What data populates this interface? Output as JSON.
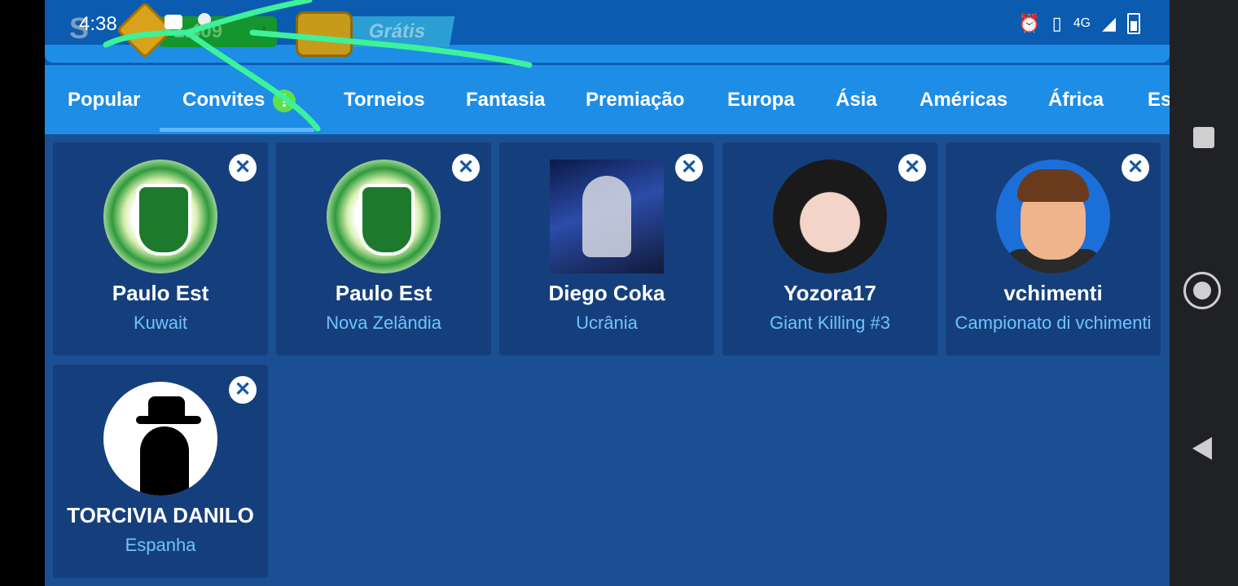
{
  "status_bar": {
    "time": "4:38",
    "network": "4G"
  },
  "header": {
    "coins": "1.409",
    "coins_plus": "+",
    "free_label": "Grátis"
  },
  "tabs": [
    {
      "label": "Popular"
    },
    {
      "label": "Convites"
    },
    {
      "label": "Torneios"
    },
    {
      "label": "Fantasia"
    },
    {
      "label": "Premiação"
    },
    {
      "label": "Europa"
    },
    {
      "label": "Ásia"
    },
    {
      "label": "Américas"
    },
    {
      "label": "África"
    },
    {
      "label": "Es"
    }
  ],
  "invites": [
    {
      "name": "Paulo Est",
      "subtitle": "Kuwait",
      "avatar": "sporting-crest"
    },
    {
      "name": "Paulo Est",
      "subtitle": "Nova Zelândia",
      "avatar": "sporting-crest"
    },
    {
      "name": "Diego Coka",
      "subtitle": "Ucrânia",
      "avatar": "game-dragon"
    },
    {
      "name": "Yozora17",
      "subtitle": "Giant Killing #3",
      "avatar": "anime-girl"
    },
    {
      "name": "vchimenti",
      "subtitle": "Campionato di vchimenti",
      "avatar": "cartoon-man"
    },
    {
      "name": "TORCIVIA DANILO",
      "subtitle": "Espanha",
      "avatar": "hat-silhouette"
    }
  ],
  "colors": {
    "accent": "#1e8de6",
    "background": "#1b4f93",
    "card": "#153f7c",
    "subtitle": "#6fc3ff"
  }
}
